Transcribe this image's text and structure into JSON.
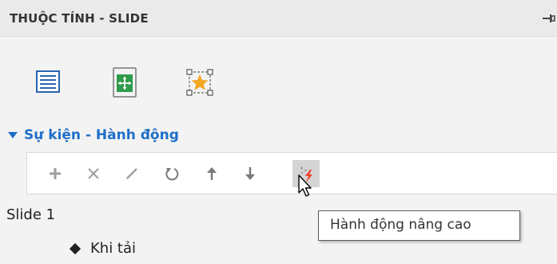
{
  "panel": {
    "title": "THUỘC TÍNH - SLIDE",
    "pin_icon": "pin-icon"
  },
  "tabs": [
    {
      "icon": "list-icon",
      "selected": false
    },
    {
      "icon": "slide-transition-icon",
      "selected": false
    },
    {
      "icon": "star-animation-icon",
      "selected": true
    }
  ],
  "section": {
    "title": "Sự kiện - Hành động",
    "expanded": true
  },
  "toolbar": {
    "buttons": [
      {
        "icon": "plus-icon",
        "state": "disabled"
      },
      {
        "icon": "x-icon",
        "state": "disabled"
      },
      {
        "icon": "pencil-icon",
        "state": "disabled"
      },
      {
        "icon": "undo-icon",
        "state": "disabled"
      },
      {
        "icon": "arrow-up-icon",
        "state": "disabled"
      },
      {
        "icon": "arrow-down-icon",
        "state": "disabled"
      },
      {
        "icon": "sparkle-lightning-icon",
        "state": "hovered"
      }
    ]
  },
  "tree": {
    "slide_label": "Slide 1",
    "event_label": "Khi tải"
  },
  "tooltip": {
    "text": "Hành động nâng cao"
  },
  "colors": {
    "accent": "#1e6fc8",
    "toolbar_bg": "#ffffff",
    "panel_bg": "#f3f3f3",
    "star": "#f5a623",
    "transition_green": "#2e9b4b",
    "lightning": "#f0452d"
  }
}
